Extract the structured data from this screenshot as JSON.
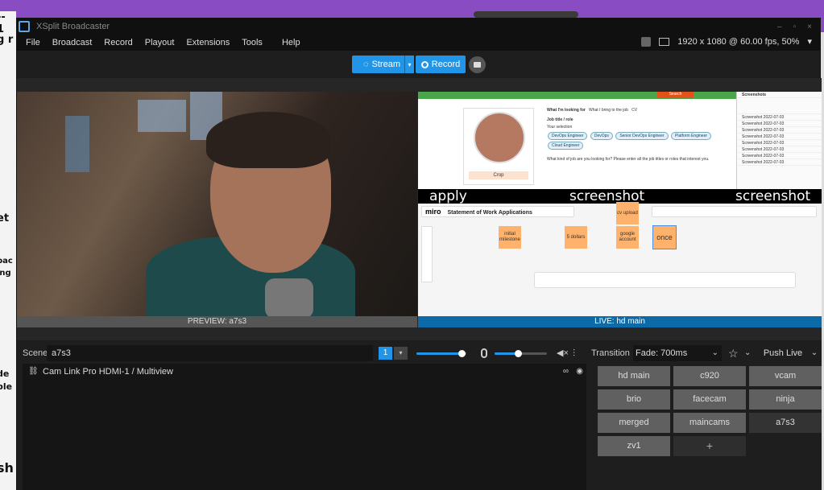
{
  "window": {
    "title": "XSplit Broadcaster",
    "controls": [
      "–",
      "▫",
      "×"
    ]
  },
  "menu": [
    "File",
    "Broadcast",
    "Record",
    "Playout",
    "Extensions",
    "Tools",
    "Help"
  ],
  "resolution": "1920 x 1080 @ 60.00 fps, 50%",
  "toolbar": {
    "stream_label": "Stream",
    "record_label": "Record"
  },
  "preview": {
    "label": "PREVIEW:   a7s3"
  },
  "live": {
    "label": "LIVE:   hd main",
    "captions": [
      "apply",
      "screenshot",
      "screenshot"
    ],
    "miro_logo": "miro",
    "miro_board": "Statement of Work Applications",
    "notes": [
      "initial milestone",
      "5 dollars",
      "cv upload",
      "google account",
      "once"
    ],
    "search_btn": "Search",
    "crop_btn": "Crop",
    "tabs": [
      "What I'm looking for",
      "What I bring to the job",
      "CV"
    ],
    "form_title": "Job title / role",
    "form_sub": "Your selection",
    "chips": [
      "DevOps Engineer",
      "DevOps",
      "Senior DevOps Engineer",
      "Platform Engineer",
      "Cloud Engineer"
    ],
    "form_q": "What kind of job are you looking for? Please enter all the job titles or roles that interest you.",
    "explorer_title": "Screenshots",
    "explorer_rows": [
      "Screenshot 2022-07-03",
      "Screenshot 2022-07-03",
      "Screenshot 2022-07-03",
      "Screenshot 2022-07-03",
      "Screenshot 2022-07-03",
      "Screenshot 2022-07-03",
      "Screenshot 2022-07-03",
      "Screenshot 2022-07-03"
    ]
  },
  "scene_bar": {
    "label": "Scene",
    "name": "a7s3",
    "number": "1"
  },
  "audio": {
    "master_level": 0.9,
    "mic_level": 0.45
  },
  "sources": [
    {
      "name": "Cam Link Pro HDMI-1 / Multiview"
    }
  ],
  "transition": {
    "label": "Transition",
    "value": "Fade: 700ms",
    "push_live": "Push Live"
  },
  "scenes": [
    {
      "name": "hd main",
      "selected": false
    },
    {
      "name": "c920",
      "selected": false
    },
    {
      "name": "vcam",
      "selected": false
    },
    {
      "name": "brio",
      "selected": false
    },
    {
      "name": "facecam",
      "selected": false
    },
    {
      "name": "ninja",
      "selected": false
    },
    {
      "name": "merged",
      "selected": false
    },
    {
      "name": "maincams",
      "selected": false
    },
    {
      "name": "a7s3",
      "selected": true
    },
    {
      "name": "zv1",
      "selected": false
    }
  ],
  "add_scene_symbol": "+",
  "desktop": {
    "left_fragments": [
      "-- 1",
      "g r",
      "et",
      "bac",
      "ing",
      "de",
      "ble",
      "sh"
    ]
  },
  "colors": {
    "accent": "#2196e8",
    "live_bar": "#0d6aa8",
    "sticky": "#ffb26b"
  }
}
